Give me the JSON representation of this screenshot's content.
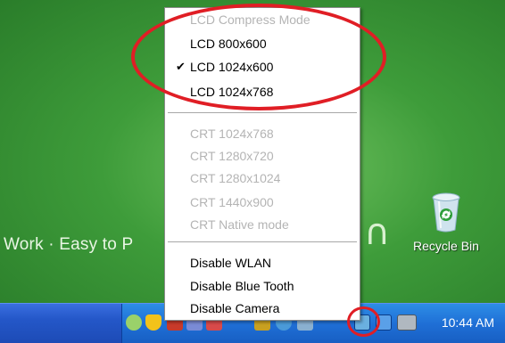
{
  "desktop": {
    "wallpaper_text": "Work · Easy to P",
    "wallpaper_glyph": "ᴄ",
    "recycle_bin_label": "Recycle Bin"
  },
  "context_menu": {
    "lcd_items": [
      {
        "label": "LCD Compress Mode",
        "enabled": false,
        "checked": false
      },
      {
        "label": "LCD 800x600",
        "enabled": true,
        "checked": false
      },
      {
        "label": "LCD 1024x600",
        "enabled": true,
        "checked": true
      },
      {
        "label": "LCD 1024x768",
        "enabled": true,
        "checked": false
      }
    ],
    "crt_items": [
      {
        "label": "CRT 1024x768",
        "enabled": false
      },
      {
        "label": "CRT 1280x720",
        "enabled": false
      },
      {
        "label": "CRT 1280x1024",
        "enabled": false
      },
      {
        "label": "CRT 1440x900",
        "enabled": false
      },
      {
        "label": "CRT Native mode",
        "enabled": false
      }
    ],
    "disable_items": [
      {
        "label": "Disable WLAN",
        "enabled": true
      },
      {
        "label": "Disable Blue Tooth",
        "enabled": true
      },
      {
        "label": "Disable Camera",
        "enabled": true
      }
    ],
    "check_mark": "✔"
  },
  "taskbar": {
    "clock": "10:44 AM",
    "tray_icons": [
      "network-icon",
      "security-shield-icon",
      "volume-icon",
      "connection-icon",
      "hotkey-icon",
      "bluetooth-icon",
      "display-icon",
      "monitor-switch-icon",
      "lan-icon",
      "screen-icon"
    ]
  },
  "annotation_color": "#e01e25"
}
